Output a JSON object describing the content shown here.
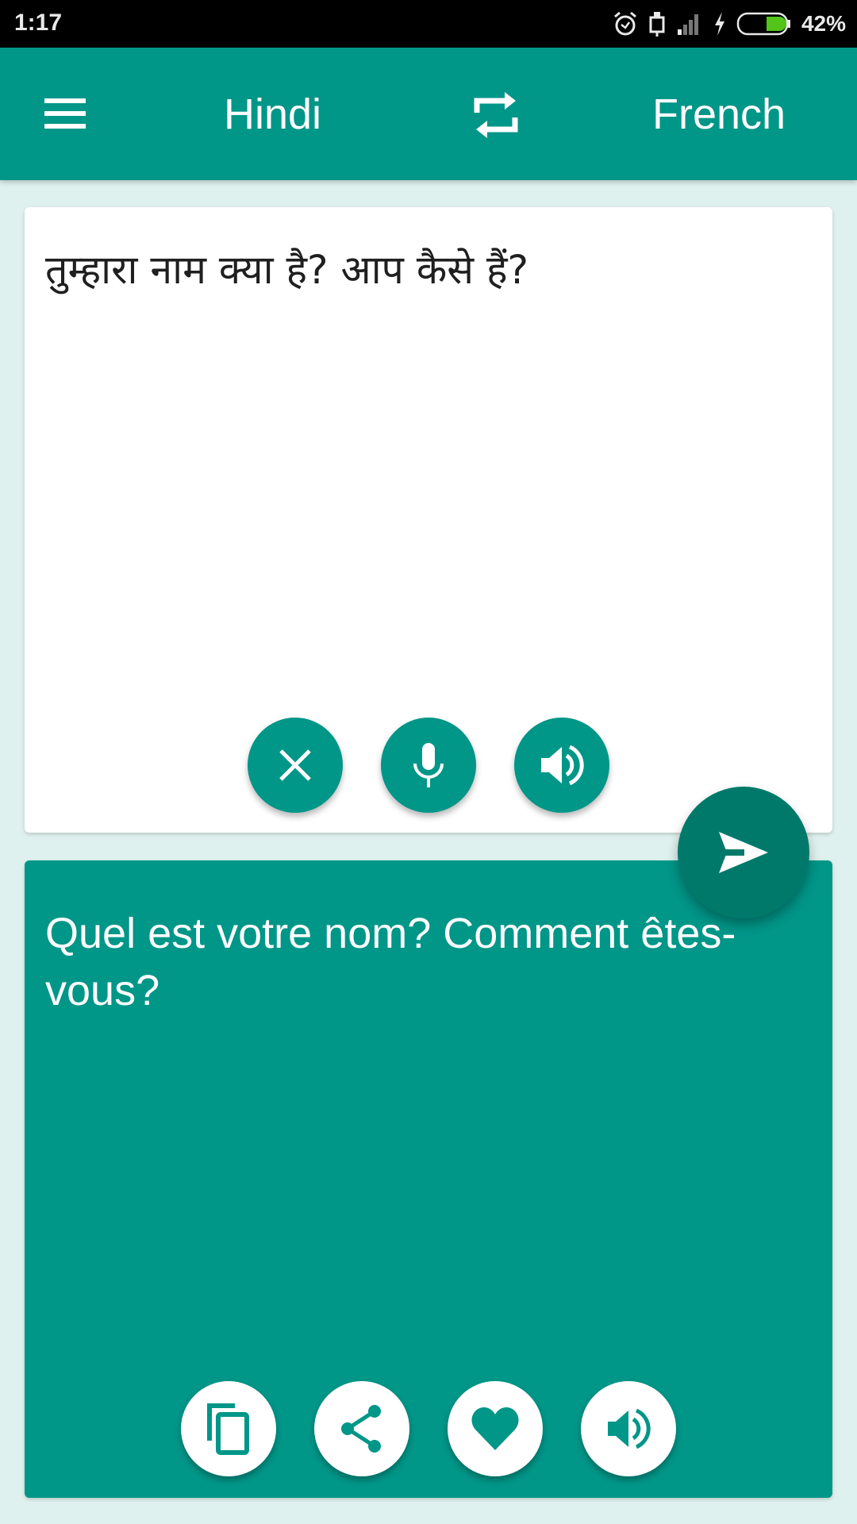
{
  "status_bar": {
    "time": "1:17",
    "battery_percent": "42%",
    "battery_level": 0.42,
    "icons": [
      "alarm-icon",
      "usb-icon",
      "signal-icon",
      "charging-icon",
      "battery-icon"
    ]
  },
  "app_bar": {
    "menu_icon": "hamburger-menu-icon",
    "source_language": "Hindi",
    "swap_icon": "swap-languages-icon",
    "target_language": "French"
  },
  "input_card": {
    "text": "तुम्हारा नाम क्या है? आप कैसे हैं?",
    "buttons": [
      {
        "icon": "close-icon",
        "label": "Clear"
      },
      {
        "icon": "microphone-icon",
        "label": "Voice input"
      },
      {
        "icon": "speaker-icon",
        "label": "Speak source"
      }
    ]
  },
  "translate_button": {
    "icon": "send-icon",
    "label": "Translate"
  },
  "output_card": {
    "text": "Quel est votre nom? Comment êtes-vous?",
    "buttons": [
      {
        "icon": "copy-icon",
        "label": "Copy"
      },
      {
        "icon": "share-icon",
        "label": "Share"
      },
      {
        "icon": "heart-icon",
        "label": "Favorite"
      },
      {
        "icon": "speaker-icon",
        "label": "Speak translation"
      }
    ]
  },
  "colors": {
    "primary": "#009688",
    "primary_dark": "#00796b",
    "background": "#dff1ee",
    "card": "#ffffff"
  }
}
